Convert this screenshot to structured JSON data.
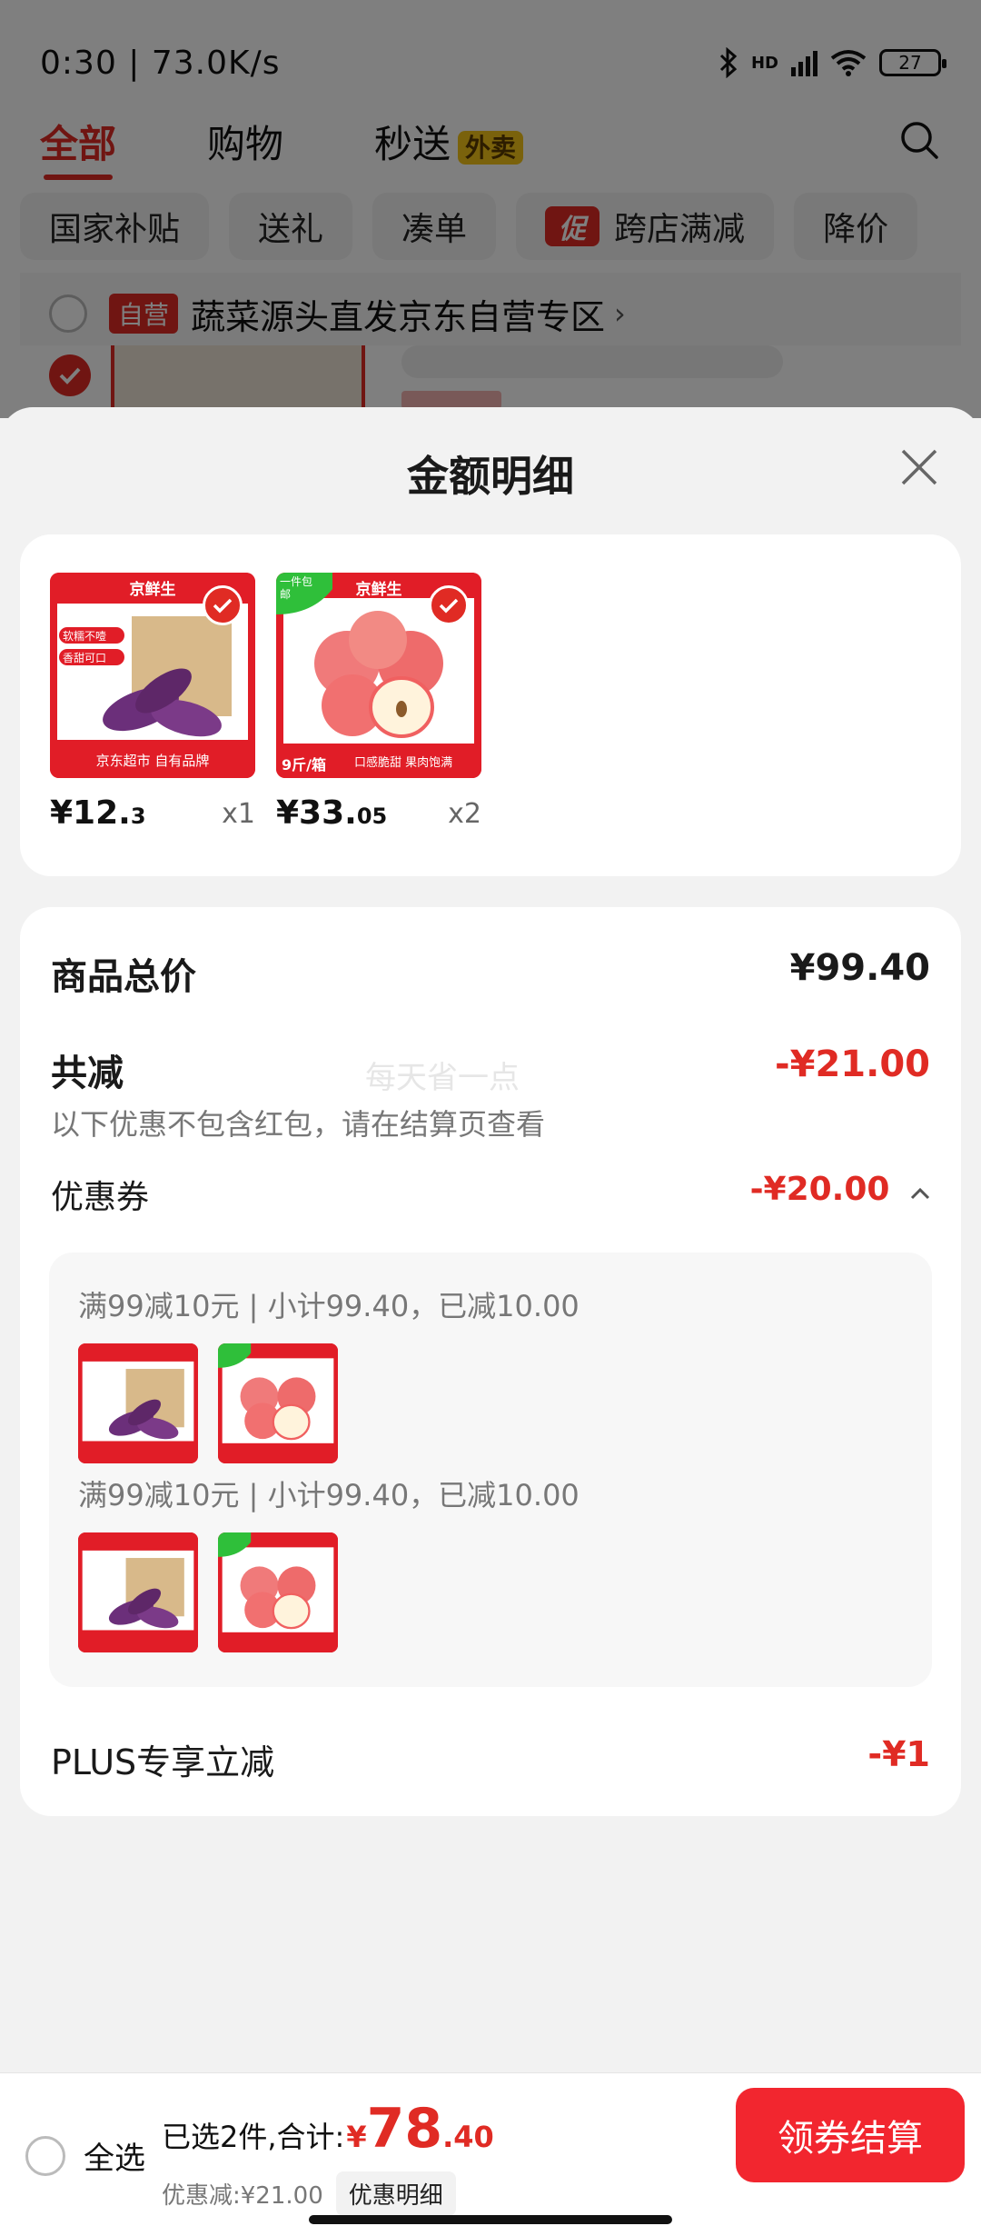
{
  "status_bar": {
    "time": "0:30 | 73.0K/s",
    "battery": "27",
    "network": "HD"
  },
  "top_tabs": [
    {
      "label": "全部",
      "active": true
    },
    {
      "label": "购物",
      "active": false
    },
    {
      "label": "秒送",
      "active": false,
      "badge": "外卖"
    }
  ],
  "filters": [
    {
      "label": "国家补贴"
    },
    {
      "label": "送礼"
    },
    {
      "label": "凑单"
    },
    {
      "label": "跨店满减",
      "mark": "促"
    },
    {
      "label": "降价"
    }
  ],
  "shop": {
    "badge": "自营",
    "name": "蔬菜源头直发京东自营专区",
    "chevron": "›"
  },
  "sheet": {
    "title": "金额明细",
    "products": [
      {
        "price_int": "¥12.",
        "price_dec": "3",
        "qty": "x1",
        "brand": "京鲜生",
        "tags": [
          "软糯不噎",
          "香甜可口"
        ],
        "footer": "京东超市 自有品牌"
      },
      {
        "price_int": "¥33.",
        "price_dec": "05",
        "qty": "x2",
        "brand": "京鲜生",
        "corner": "一件包邮",
        "footer": "口感脆甜 果肉饱满",
        "weight": "9斤/箱"
      }
    ],
    "total_label": "商品总价",
    "total_value": "¥99.40",
    "reduce_label": "共减",
    "reduce_value": "-¥21.00",
    "watermark": "每天省一点",
    "reduce_note": "以下优惠不包含红包，请在结算页查看",
    "coupon_label": "优惠券",
    "coupon_value": "-¥20.00",
    "coupon_groups": [
      {
        "text": "满99减10元 | 小计99.40，已减10.00"
      },
      {
        "text": "满99减10元 | 小计99.40，已减10.00"
      }
    ],
    "plus_label": "PLUS专享立减",
    "plus_value": "-¥1"
  },
  "bottom_bar": {
    "select_all": "全选",
    "selected_text": "已选2件,合计:",
    "yen": "¥",
    "total_int": "78",
    "total_dec": ".40",
    "discount_text": "优惠减:¥21.00",
    "detail_button": "优惠明细",
    "checkout_button": "领券结算"
  },
  "colors": {
    "accent": "#e02b24",
    "checkout": "#f2262f",
    "overlay": "rgba(0,0,0,0.5)"
  },
  "icons": [
    "bluetooth-icon",
    "signal-icon",
    "wifi-icon",
    "battery-icon",
    "search-icon",
    "close-icon",
    "check-icon",
    "chevron-up-icon"
  ]
}
